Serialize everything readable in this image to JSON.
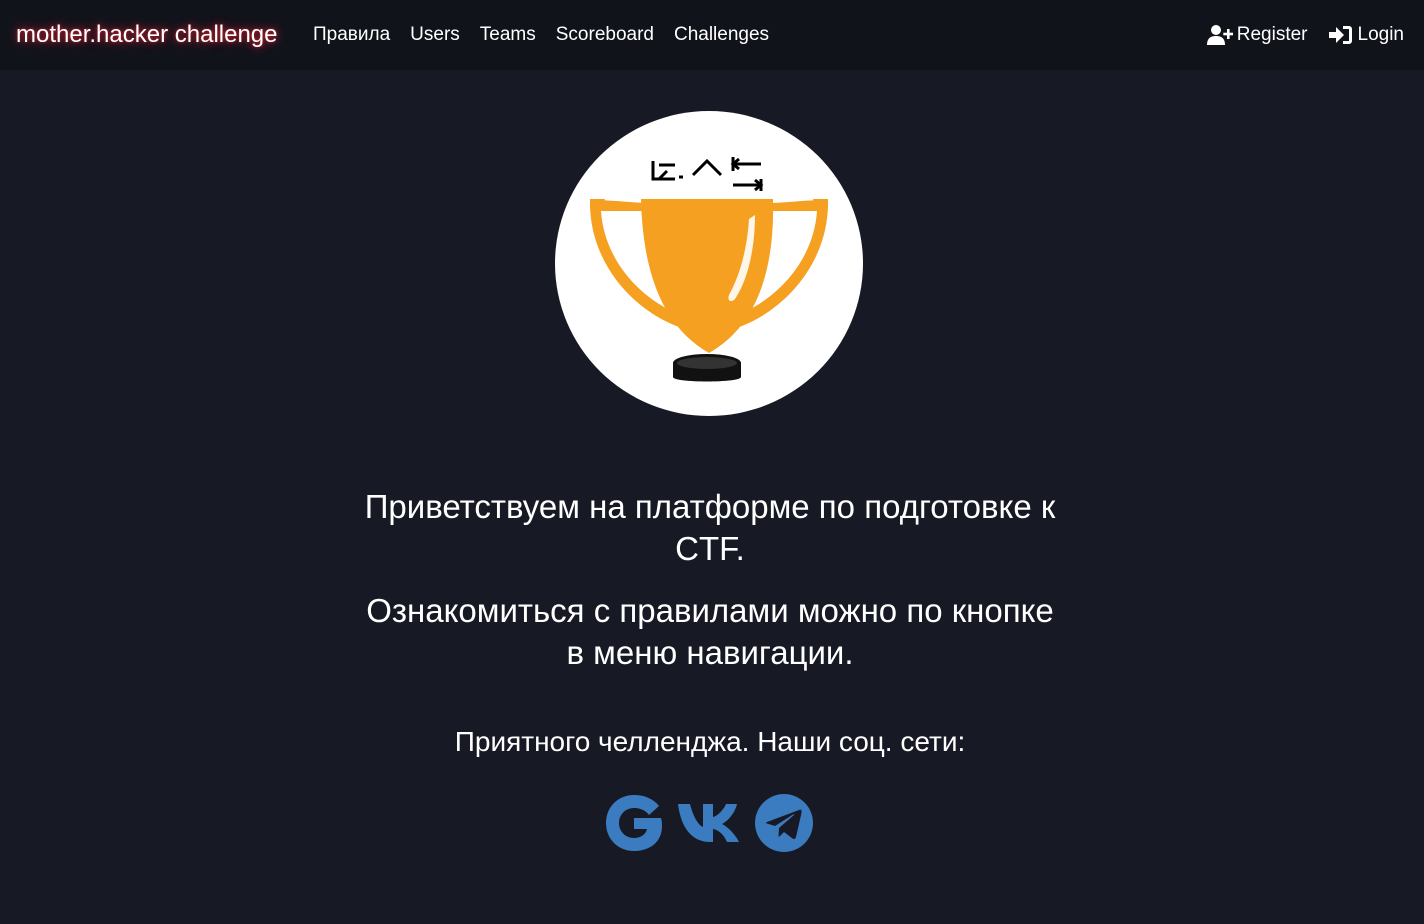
{
  "navbar": {
    "brand": "mother.hacker challenge",
    "links": [
      "Правила",
      "Users",
      "Teams",
      "Scoreboard",
      "Challenges"
    ],
    "register_label": "Register",
    "login_label": "Login",
    "register_icon": "user-plus-icon",
    "login_icon": "sign-in-icon"
  },
  "logo": {
    "name": "trophy-logo",
    "accent_color": "#f5a020"
  },
  "main": {
    "welcome": "Приветствуем на платформе по подготовке к CTF.",
    "rules_hint": "Ознакомиться с правилами можно по кнопке в меню навигации.",
    "social_intro": "Приятного челленджа. Наши соц. сети:"
  },
  "social": {
    "color": "#3b7bbf",
    "items": [
      "google-icon",
      "vk-icon",
      "telegram-icon"
    ]
  }
}
